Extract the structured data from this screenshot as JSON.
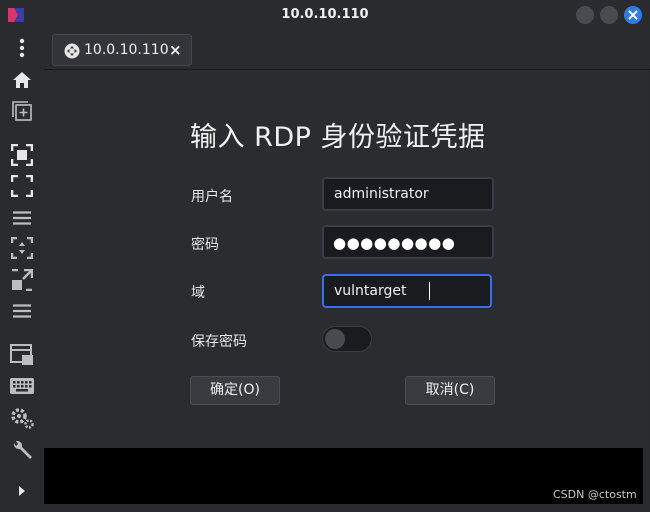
{
  "window": {
    "title": "10.0.10.110",
    "controls": [
      "minimize",
      "maximize",
      "close"
    ]
  },
  "tab": {
    "label": "10.0.10.110",
    "close_glyph": "×",
    "icon": "connection-icon"
  },
  "sidebar": {
    "icons": [
      "more-vertical-icon",
      "home-icon",
      "new-window-icon",
      "fit-window-icon",
      "fullscreen-icon",
      "menu-icon",
      "scaled-fit-icon",
      "resize-icon",
      "menu-icon",
      "multi-monitor-icon",
      "keyboard-icon",
      "preferences-icon",
      "tools-icon",
      "expand-icon"
    ]
  },
  "dialog": {
    "title": "输入 RDP 身份验证凭据",
    "username_label": "用户名",
    "username_value": "administrator",
    "password_label": "密码",
    "password_masked": "●●●●●●●●●",
    "domain_label": "域",
    "domain_value": "vulntarget",
    "save_password_label": "保存密码",
    "save_password_on": false,
    "ok_label": "确定(O)",
    "cancel_label": "取消(C)"
  },
  "watermark": "CSDN @ctostm",
  "colors": {
    "background": "#2b2c30",
    "focus_accent": "#3a6fe0",
    "close_button": "#2f7ce6"
  }
}
